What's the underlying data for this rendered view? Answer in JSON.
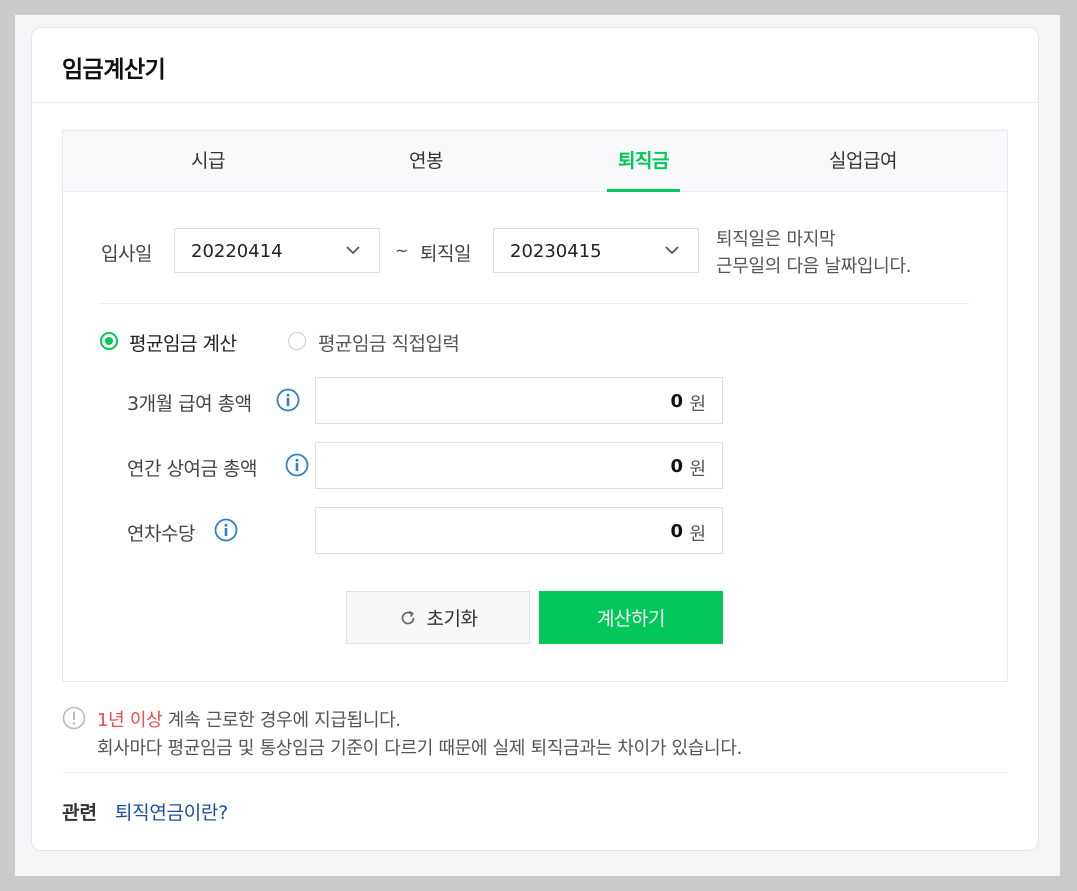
{
  "header": {
    "title": "임금계산기"
  },
  "tabs": [
    {
      "label": "시급"
    },
    {
      "label": "연봉"
    },
    {
      "label": "퇴직금",
      "active": true
    },
    {
      "label": "실업급여"
    }
  ],
  "dates": {
    "start_label": "입사일",
    "start_value": "20220414",
    "separator": "~",
    "end_label": "퇴직일",
    "end_value": "20230415",
    "note_line1": "퇴직일은 마지막",
    "note_line2": "근무일의 다음 날짜입니다."
  },
  "mode": {
    "option_calc": "평균임금 계산",
    "option_direct": "평균임금 직접입력",
    "selected": "option_calc"
  },
  "fields": [
    {
      "label": "3개월 급여 총액",
      "value": "0",
      "unit": "원"
    },
    {
      "label": "연간 상여금 총액",
      "value": "0",
      "unit": "원"
    },
    {
      "label": "연차수당",
      "value": "0",
      "unit": "원"
    }
  ],
  "buttons": {
    "reset": "초기화",
    "calculate": "계산하기"
  },
  "info": {
    "line1_highlight": "1년 이상",
    "line1_rest": " 계속 근로한 경우에 지급됩니다.",
    "line2": "회사마다 평균임금 및 통상임금 기준이 다르기 때문에 실제 퇴직금과는 차이가 있습니다."
  },
  "related": {
    "label": "관련",
    "link": "퇴직연금이란?"
  },
  "colors": {
    "accent": "#03c75a",
    "highlight": "#f04b4b",
    "link": "#1c4fa3",
    "info_icon": "#2f7fd1"
  }
}
